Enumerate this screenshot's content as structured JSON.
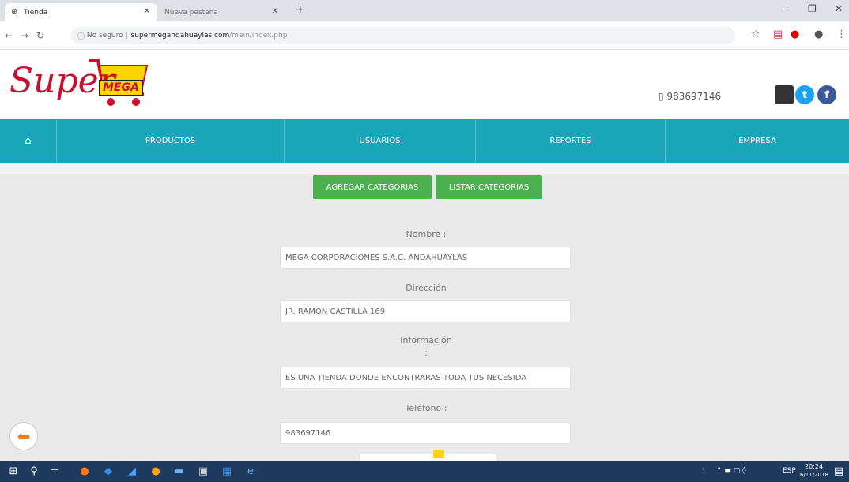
{
  "browser": {
    "active_tab": "Tienda",
    "inactive_tab": "Nueva pestaña",
    "security_label": "No seguro",
    "url_host": "supermegandahuaylas.com",
    "url_path": "/main/index.php"
  },
  "header": {
    "logo_super": "Super",
    "logo_mega": "MEGA",
    "phone": "983697146"
  },
  "nav": {
    "items": [
      "PRODUCTOS",
      "USUARIOS",
      "REPORTES",
      "EMPRESA"
    ]
  },
  "actions": {
    "add_category": "AGREGAR CATEGORIAS",
    "list_categories": "LISTAR CATEGORIAS"
  },
  "form": {
    "nombre_label": "Nombre :",
    "nombre_value": "MEGA CORPORACIONES S.A.C. ANDAHUAYLAS",
    "direccion_label": "Dirección",
    "direccion_value": "JR. RAMÓN CASTILLA 169",
    "informacion_label": "Información",
    "informacion_sub": ":",
    "informacion_value": "ES UNA TIENDA DONDE ENCONTRARAS TODA TUS NECESIDA",
    "telefono_label": "Teléfono :",
    "telefono_value": "983697146"
  },
  "taskbar": {
    "lang": "ESP",
    "time": "20:24",
    "date": "6/11/2018"
  },
  "colors": {
    "brand_red": "#c8102e",
    "brand_yellow": "#ffd400",
    "nav_teal": "#1aa5b8",
    "button_green": "#4caf50",
    "taskbar": "#1e3a5f"
  }
}
